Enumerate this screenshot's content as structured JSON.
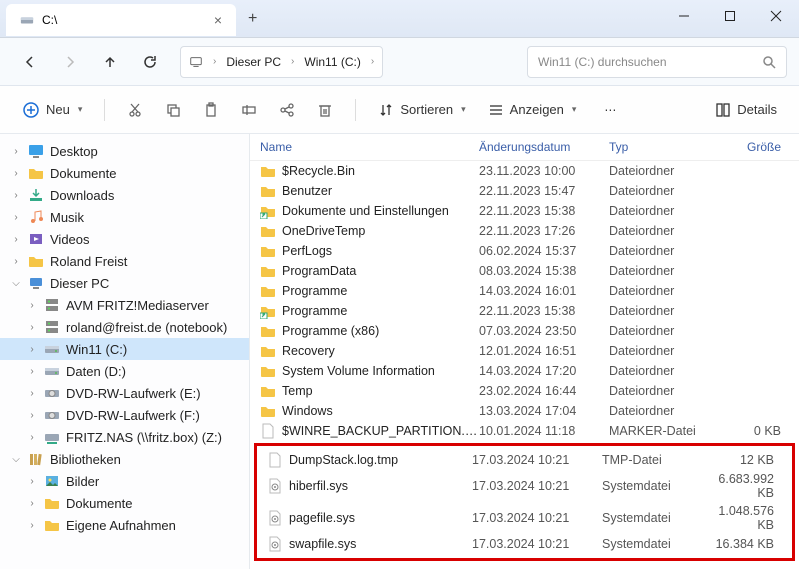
{
  "tab": {
    "title": "C:\\"
  },
  "breadcrumb": {
    "items": [
      "Dieser PC",
      "Win11 (C:)"
    ]
  },
  "search": {
    "placeholder": "Win11 (C:) durchsuchen"
  },
  "toolbar": {
    "new": "Neu",
    "sort": "Sortieren",
    "view": "Anzeigen",
    "details": "Details"
  },
  "sidebar": [
    {
      "twist": ">",
      "icon": "desktop",
      "label": "Desktop",
      "depth": 0
    },
    {
      "twist": ">",
      "icon": "folder",
      "label": "Dokumente",
      "depth": 0
    },
    {
      "twist": ">",
      "icon": "download",
      "label": "Downloads",
      "depth": 0
    },
    {
      "twist": ">",
      "icon": "music",
      "label": "Musik",
      "depth": 0
    },
    {
      "twist": ">",
      "icon": "video",
      "label": "Videos",
      "depth": 0
    },
    {
      "twist": ">",
      "icon": "folder",
      "label": "Roland Freist",
      "depth": 0
    },
    {
      "twist": "v",
      "icon": "pc",
      "label": "Dieser PC",
      "depth": 0
    },
    {
      "twist": ">",
      "icon": "server",
      "label": "AVM FRITZ!Mediaserver",
      "depth": 1
    },
    {
      "twist": ">",
      "icon": "server",
      "label": "roland@freist.de (notebook)",
      "depth": 1
    },
    {
      "twist": ">",
      "icon": "drive",
      "label": "Win11 (C:)",
      "depth": 1,
      "selected": true
    },
    {
      "twist": ">",
      "icon": "drive",
      "label": "Daten (D:)",
      "depth": 1
    },
    {
      "twist": ">",
      "icon": "optical",
      "label": "DVD-RW-Laufwerk (E:)",
      "depth": 1
    },
    {
      "twist": ">",
      "icon": "optical",
      "label": "DVD-RW-Laufwerk (F:)",
      "depth": 1
    },
    {
      "twist": ">",
      "icon": "netdrive",
      "label": "FRITZ.NAS (\\\\fritz.box) (Z:)",
      "depth": 1
    },
    {
      "twist": "v",
      "icon": "library",
      "label": "Bibliotheken",
      "depth": 0
    },
    {
      "twist": ">",
      "icon": "pictures",
      "label": "Bilder",
      "depth": 1
    },
    {
      "twist": ">",
      "icon": "folder",
      "label": "Dokumente",
      "depth": 1
    },
    {
      "twist": ">",
      "icon": "folder",
      "label": "Eigene Aufnahmen",
      "depth": 1
    }
  ],
  "columns": {
    "name": "Name",
    "date": "Änderungsdatum",
    "type": "Typ",
    "size": "Größe"
  },
  "files_top": [
    {
      "icon": "folder",
      "name": "$Recycle.Bin",
      "date": "23.11.2023 10:00",
      "type": "Dateiordner",
      "size": ""
    },
    {
      "icon": "folder",
      "name": "Benutzer",
      "date": "22.11.2023 15:47",
      "type": "Dateiordner",
      "size": ""
    },
    {
      "icon": "shortcut",
      "name": "Dokumente und Einstellungen",
      "date": "22.11.2023 15:38",
      "type": "Dateiordner",
      "size": ""
    },
    {
      "icon": "folder",
      "name": "OneDriveTemp",
      "date": "22.11.2023 17:26",
      "type": "Dateiordner",
      "size": ""
    },
    {
      "icon": "folder",
      "name": "PerfLogs",
      "date": "06.02.2024 15:37",
      "type": "Dateiordner",
      "size": ""
    },
    {
      "icon": "folder",
      "name": "ProgramData",
      "date": "08.03.2024 15:38",
      "type": "Dateiordner",
      "size": ""
    },
    {
      "icon": "folder",
      "name": "Programme",
      "date": "14.03.2024 16:01",
      "type": "Dateiordner",
      "size": ""
    },
    {
      "icon": "shortcut",
      "name": "Programme",
      "date": "22.11.2023 15:38",
      "type": "Dateiordner",
      "size": ""
    },
    {
      "icon": "folder",
      "name": "Programme (x86)",
      "date": "07.03.2024 23:50",
      "type": "Dateiordner",
      "size": ""
    },
    {
      "icon": "folder",
      "name": "Recovery",
      "date": "12.01.2024 16:51",
      "type": "Dateiordner",
      "size": ""
    },
    {
      "icon": "folder",
      "name": "System Volume Information",
      "date": "14.03.2024 17:20",
      "type": "Dateiordner",
      "size": ""
    },
    {
      "icon": "folder",
      "name": "Temp",
      "date": "23.02.2024 16:44",
      "type": "Dateiordner",
      "size": ""
    },
    {
      "icon": "folder",
      "name": "Windows",
      "date": "13.03.2024 17:04",
      "type": "Dateiordner",
      "size": ""
    },
    {
      "icon": "file",
      "name": "$WINRE_BACKUP_PARTITION.MARKER",
      "date": "10.01.2024 11:18",
      "type": "MARKER-Datei",
      "size": "0 KB"
    }
  ],
  "files_highlighted": [
    {
      "icon": "file",
      "name": "DumpStack.log.tmp",
      "date": "17.03.2024 10:21",
      "type": "TMP-Datei",
      "size": "12 KB"
    },
    {
      "icon": "sysfile",
      "name": "hiberfil.sys",
      "date": "17.03.2024 10:21",
      "type": "Systemdatei",
      "size": "6.683.992 KB"
    },
    {
      "icon": "sysfile",
      "name": "pagefile.sys",
      "date": "17.03.2024 10:21",
      "type": "Systemdatei",
      "size": "1.048.576 KB"
    },
    {
      "icon": "sysfile",
      "name": "swapfile.sys",
      "date": "17.03.2024 10:21",
      "type": "Systemdatei",
      "size": "16.384 KB"
    }
  ]
}
